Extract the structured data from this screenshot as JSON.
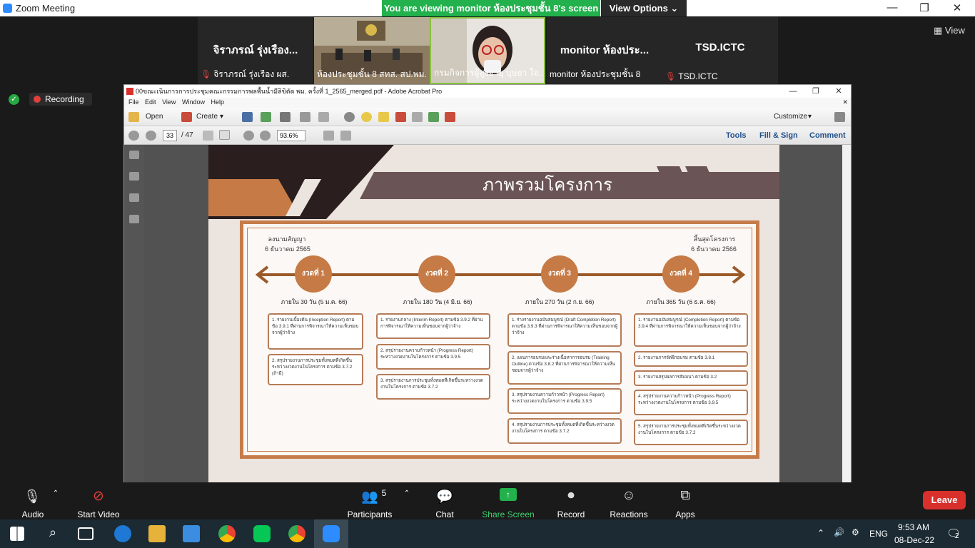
{
  "zoom": {
    "window_title": "Zoom Meeting",
    "banner": "You are viewing monitor ห้องประชุมชั้น 8's screen",
    "view_options": "View Options ⌄",
    "view_label": "View",
    "recording_label": "Recording",
    "participants": [
      {
        "big": "จิราภรณ์ รุ่งเรือง...",
        "name": "จิราภรณ์ รุ่งเรือง ผส.",
        "muted": true,
        "video": false
      },
      {
        "big": "",
        "name": "ห้องประชุมชั้น 8 สทส. สป.พม.",
        "muted": false,
        "video": true
      },
      {
        "big": "",
        "name": "กรมกิจการผู้สูงอายุ บุษยา ใจ...",
        "muted": false,
        "video": true
      },
      {
        "big": "monitor ห้องประ...",
        "name": "monitor ห้องประชุมชั้น 8",
        "muted": false,
        "video": false
      },
      {
        "big": "TSD.ICTC",
        "name": "TSD.ICTC",
        "muted": true,
        "video": false
      }
    ],
    "controls": {
      "audio": "Audio",
      "start_video": "Start Video",
      "participants": "Participants",
      "participants_count": "5",
      "chat": "Chat",
      "share_screen": "Share Screen",
      "record": "Record",
      "reactions": "Reactions",
      "apps": "Apps",
      "leave": "Leave"
    }
  },
  "acrobat": {
    "title": "00ขณะเนินการการประชุมคณะกรรมการพลพื้นน้ำมีลิขิตัด พม. ครั้งที่ 1_2565_merged.pdf - Adobe Acrobat Pro",
    "menu": [
      "File",
      "Edit",
      "View",
      "Window",
      "Help"
    ],
    "open_label": "Open",
    "create_label": "Create",
    "customize_label": "Customize",
    "page_current": "33",
    "page_total": "/ 47",
    "zoom_value": "93.6%",
    "tools_label": "Tools",
    "fill_sign_label": "Fill & Sign",
    "comment_label": "Comment"
  },
  "slide": {
    "title": "ภาพรวมโครงการ",
    "start_label": "ลงนามสัญญา",
    "start_date": "6 ธันวาคม 2565",
    "end_label": "สิ้นสุดโครงการ",
    "end_date": "6 ธันวาคม 2566",
    "phases": [
      {
        "name": "งวดที่ 1",
        "duration": "ภายใน 30 วัน (5 ม.ค. 66)",
        "items": [
          "1. รายงานเบื้องต้น (Inception Report) ตามข้อ 3.9.1 ที่ผ่านการพิจารณาให้ความเห็นชอบจากผู้ว่าจ้าง",
          "2. สรุปรายงานการประชุมทั้งหมดที่เกิดขึ้นระหว่างงวดงานในโครงการ ตามข้อ 3.7.2 (ถ้ามี)"
        ]
      },
      {
        "name": "งวดที่ 2",
        "duration": "ภายใน 180 วัน (4 มิ.ย. 66)",
        "items": [
          "1. รายงานกลาง (Interim Report) ตามข้อ 3.9.2 ที่ผ่านการพิจารณาให้ความเห็นชอบจากผู้ว่าจ้าง",
          "2. สรุปรายงานความก้าวหน้า (Progress Report) ระหว่างงวดงานในโครงการ ตามข้อ 3.9.5",
          "3. สรุปรายงานการประชุมทั้งหมดที่เกิดขึ้นระหว่างงวดงานในโครงการ ตามข้อ 3.7.2"
        ]
      },
      {
        "name": "งวดที่ 3",
        "duration": "ภายใน 270 วัน (2 ก.ย. 66)",
        "items": [
          "1. ร่างรายงานฉบับสมบูรณ์ (Draft Completion Report) ตามข้อ 3.9.3 ที่ผ่านการพิจารณาให้ความเห็นชอบจากผู้ว่าจ้าง",
          "2. แผนการอบรมและร่างเนื้อหาการอบรม (Training Outline) ตามข้อ 3.8.2 ที่ผ่านการพิจารณาให้ความเห็นชอบจากผู้ว่าจ้าง",
          "3. สรุปรายงานความก้าวหน้า (Progress Report) ระหว่างงวดงานในโครงการ ตามข้อ 3.9.5",
          "4. สรุปรายงานการประชุมทั้งหมดที่เกิดขึ้นระหว่างงวดงานในโครงการ ตามข้อ 3.7.2"
        ]
      },
      {
        "name": "งวดที่ 4",
        "duration": "ภายใน 365 วัน (6 ธ.ค. 66)",
        "items": [
          "1. รายงานฉบับสมบูรณ์ (Completion Report) ตามข้อ 3.9.4 ที่ผ่านการพิจารณาให้ความเห็นชอบจากผู้ว่าจ้าง",
          "2. รายงานการจัดฝึกอบรม ตามข้อ 3.8.1",
          "3. รายงานสรุปผลการสัมมนา ตามข้อ 3.2",
          "4. สรุปรายงานความก้าวหน้า (Progress Report) ระหว่างงวดงานในโครงการ ตามข้อ 3.9.5",
          "5. สรุปรายงานการประชุมทั้งหมดที่เกิดขึ้นระหว่างงวดงานในโครงการ ตามข้อ 3.7.2"
        ]
      }
    ]
  },
  "taskbar": {
    "language": "ENG",
    "time": "9:53 AM",
    "date": "08-Dec-22",
    "notification_count": "2"
  },
  "colors": {
    "zoom_green": "#22b14c",
    "leave_red": "#d9302c",
    "slide_brown": "#c67b46",
    "slide_dark": "#2a1e1f"
  }
}
